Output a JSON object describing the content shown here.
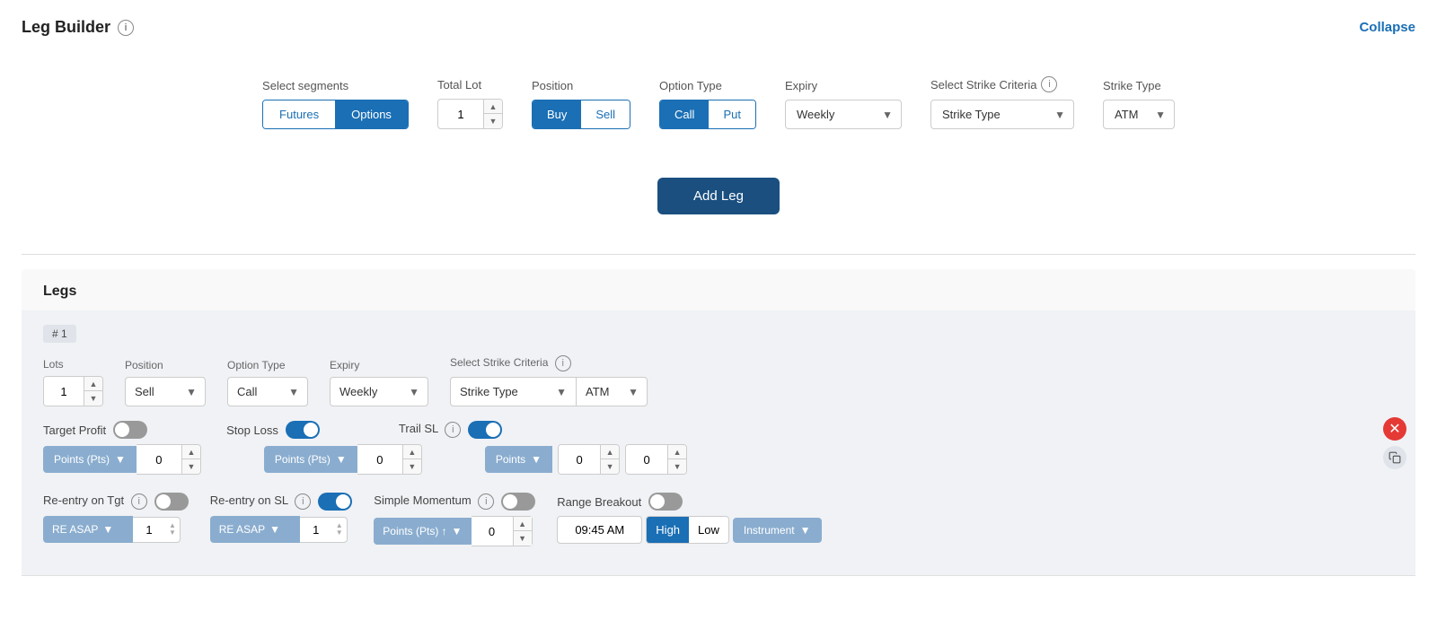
{
  "header": {
    "title": "Leg Builder",
    "collapse_label": "Collapse"
  },
  "builder": {
    "select_segments_label": "Select segments",
    "futures_label": "Futures",
    "options_label": "Options",
    "total_lot_label": "Total Lot",
    "lot_value": "1",
    "position_label": "Position",
    "buy_label": "Buy",
    "sell_label": "Sell",
    "option_type_label": "Option Type",
    "call_label": "Call",
    "put_label": "Put",
    "expiry_label": "Expiry",
    "expiry_value": "Weekly",
    "strike_criteria_label": "Select Strike Criteria",
    "strike_type_placeholder": "Strike Type",
    "strike_type_label": "Strike Type",
    "atm_label": "ATM",
    "add_leg_label": "Add Leg"
  },
  "legs_section": {
    "title": "Legs"
  },
  "leg1": {
    "tag": "# 1",
    "lots_label": "Lots",
    "lots_value": "1",
    "position_label": "Position",
    "position_value": "Sell",
    "option_type_label": "Option Type",
    "option_type_value": "Call",
    "expiry_label": "Expiry",
    "expiry_value": "Weekly",
    "strike_criteria_label": "Select Strike Criteria",
    "strike_type_value": "Strike Type",
    "atm_value": "ATM",
    "target_profit_label": "Target Profit",
    "stop_loss_label": "Stop Loss",
    "trail_sl_label": "Trail SL",
    "points_pts_label": "Points (Pts)",
    "points_value1": "0",
    "points_value2": "0",
    "points_label": "Points",
    "trail_val1": "0",
    "trail_val2": "0",
    "reentry_tgt_label": "Re-entry on Tgt",
    "reentry_sl_label": "Re-entry on SL",
    "simple_momentum_label": "Simple Momentum",
    "range_breakout_label": "Range Breakout",
    "re_asap_label": "RE ASAP",
    "reentry_num1": "1",
    "reentry_num2": "1",
    "points_pts_up_label": "Points (Pts) ↑",
    "momentum_value": "0",
    "time_value": "09:45 AM",
    "high_label": "High",
    "low_label": "Low",
    "instrument_label": "Instrument"
  }
}
